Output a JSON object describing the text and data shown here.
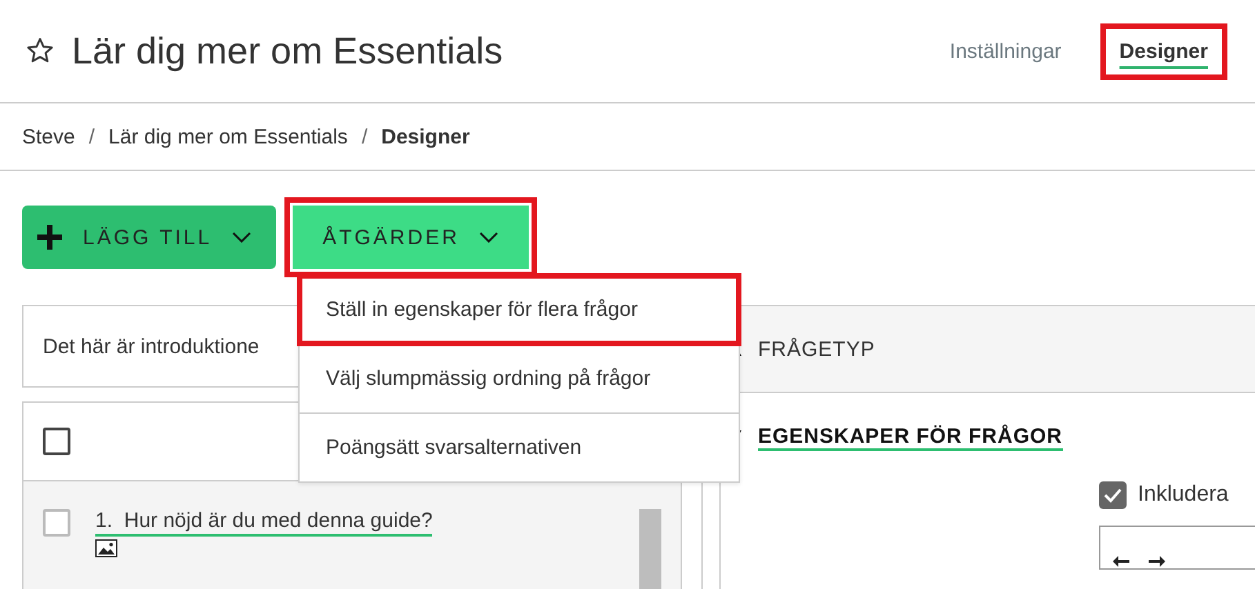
{
  "header": {
    "title": "Lär dig mer om Essentials",
    "tabs": [
      {
        "label": "Inställningar",
        "selected": false,
        "highlighted": false
      },
      {
        "label": "Designer",
        "selected": true,
        "highlighted": true
      }
    ]
  },
  "breadcrumb": [
    {
      "label": "Steve",
      "current": false
    },
    {
      "separator": "/",
      "label": "Lär dig mer om Essentials",
      "current": false
    },
    {
      "separator": "/",
      "label": "Designer",
      "current": true
    }
  ],
  "toolbar": {
    "buttons": [
      {
        "label": "LÄGG TILL",
        "kind": "add",
        "highlighted": false
      },
      {
        "label": "ÅTGÄRDER",
        "kind": "actions",
        "highlighted": true
      }
    ]
  },
  "dropdown": {
    "items": [
      {
        "label": "Ställ in egenskaper för flera frågor",
        "highlighted": true
      },
      {
        "label": "Välj slumpmässig ordning på frågor",
        "highlighted": false
      },
      {
        "label": "Poängsätt svarsalternativen",
        "highlighted": false
      }
    ]
  },
  "intro": {
    "text": "Det här är introduktione"
  },
  "questions": {
    "select_all": {
      "checked": false
    },
    "items": [
      {
        "number": "1.",
        "text": "Hur nöjd är du med denna guide?",
        "checked": false,
        "has_image": true
      }
    ]
  },
  "sections": [
    {
      "label": "FRÅGETYP",
      "expanded": false
    },
    {
      "label": "EGENSKAPER FÖR FRÅGOR",
      "expanded": true
    }
  ],
  "properties": {
    "option": {
      "label": "Inkludera",
      "checked": true
    }
  }
}
